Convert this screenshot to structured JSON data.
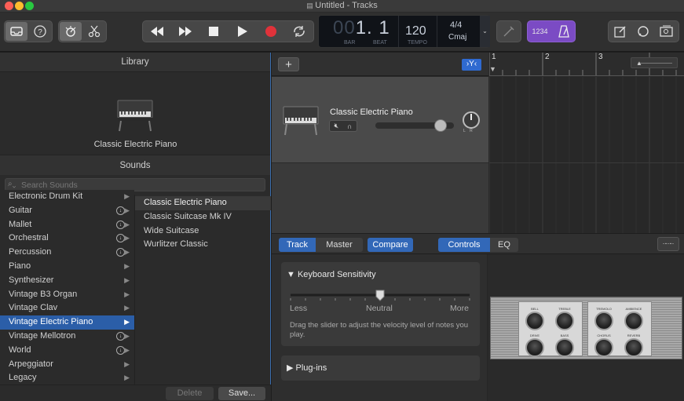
{
  "window": {
    "title": "Untitled - Tracks"
  },
  "transport": {
    "bar_display": "00",
    "beat_display": "1. 1",
    "bar_label": "BAR",
    "beat_label": "BEAT",
    "tempo": "120",
    "tempo_label": "TEMPO",
    "time_signature": "4/4",
    "key": "Cmaj",
    "count_in": "1234"
  },
  "library": {
    "header": "Library",
    "preview_name": "Classic Electric Piano",
    "sounds_header": "Sounds",
    "search_placeholder": "Search Sounds",
    "categories": [
      {
        "label": "Electronic Drum Kit",
        "download": false
      },
      {
        "label": "Guitar",
        "download": true
      },
      {
        "label": "Mallet",
        "download": true
      },
      {
        "label": "Orchestral",
        "download": true
      },
      {
        "label": "Percussion",
        "download": true
      },
      {
        "label": "Piano",
        "download": false
      },
      {
        "label": "Synthesizer",
        "download": false
      },
      {
        "label": "Vintage B3 Organ",
        "download": false
      },
      {
        "label": "Vintage Clav",
        "download": false
      },
      {
        "label": "Vintage Electric Piano",
        "download": false,
        "selected": true
      },
      {
        "label": "Vintage Mellotron",
        "download": true
      },
      {
        "label": "World",
        "download": true
      },
      {
        "label": "Arpeggiator",
        "download": false
      },
      {
        "label": "Legacy",
        "download": false
      }
    ],
    "patches": [
      {
        "label": "Classic Electric Piano",
        "selected": true
      },
      {
        "label": "Classic Suitcase Mk IV"
      },
      {
        "label": "Wide Suitcase"
      },
      {
        "label": "Wurlitzer Classic"
      }
    ],
    "delete_label": "Delete",
    "save_label": "Save..."
  },
  "tracks": {
    "add_label": "+",
    "ruler": [
      "1",
      "2",
      "3"
    ],
    "track_name": "Classic Electric Piano",
    "volume": 0.83
  },
  "editor": {
    "tabs": {
      "track": "Track",
      "master": "Master",
      "compare": "Compare"
    },
    "subtabs": {
      "controls": "Controls",
      "eq": "EQ"
    },
    "keyboard_sensitivity": {
      "title": "Keyboard Sensitivity",
      "less": "Less",
      "neutral": "Neutral",
      "more": "More",
      "description": "Drag the slider to adjust the velocity level of notes you play.",
      "value": 0.5
    },
    "plugins_label": "Plug-ins",
    "panel_knobs": [
      {
        "label": "BELL"
      },
      {
        "label": "TREBLE"
      },
      {
        "label": "TREMOLO"
      },
      {
        "label": "AMBIENCE"
      },
      {
        "label": "DRIVE"
      },
      {
        "label": "BASS"
      },
      {
        "label": "CHORUS"
      },
      {
        "label": "REVERB"
      }
    ]
  },
  "colors": {
    "accent": "#3a6fb0",
    "selected_row": "#2b5ea8",
    "record": "#e0323a",
    "count_in": "#7b4bc4"
  }
}
